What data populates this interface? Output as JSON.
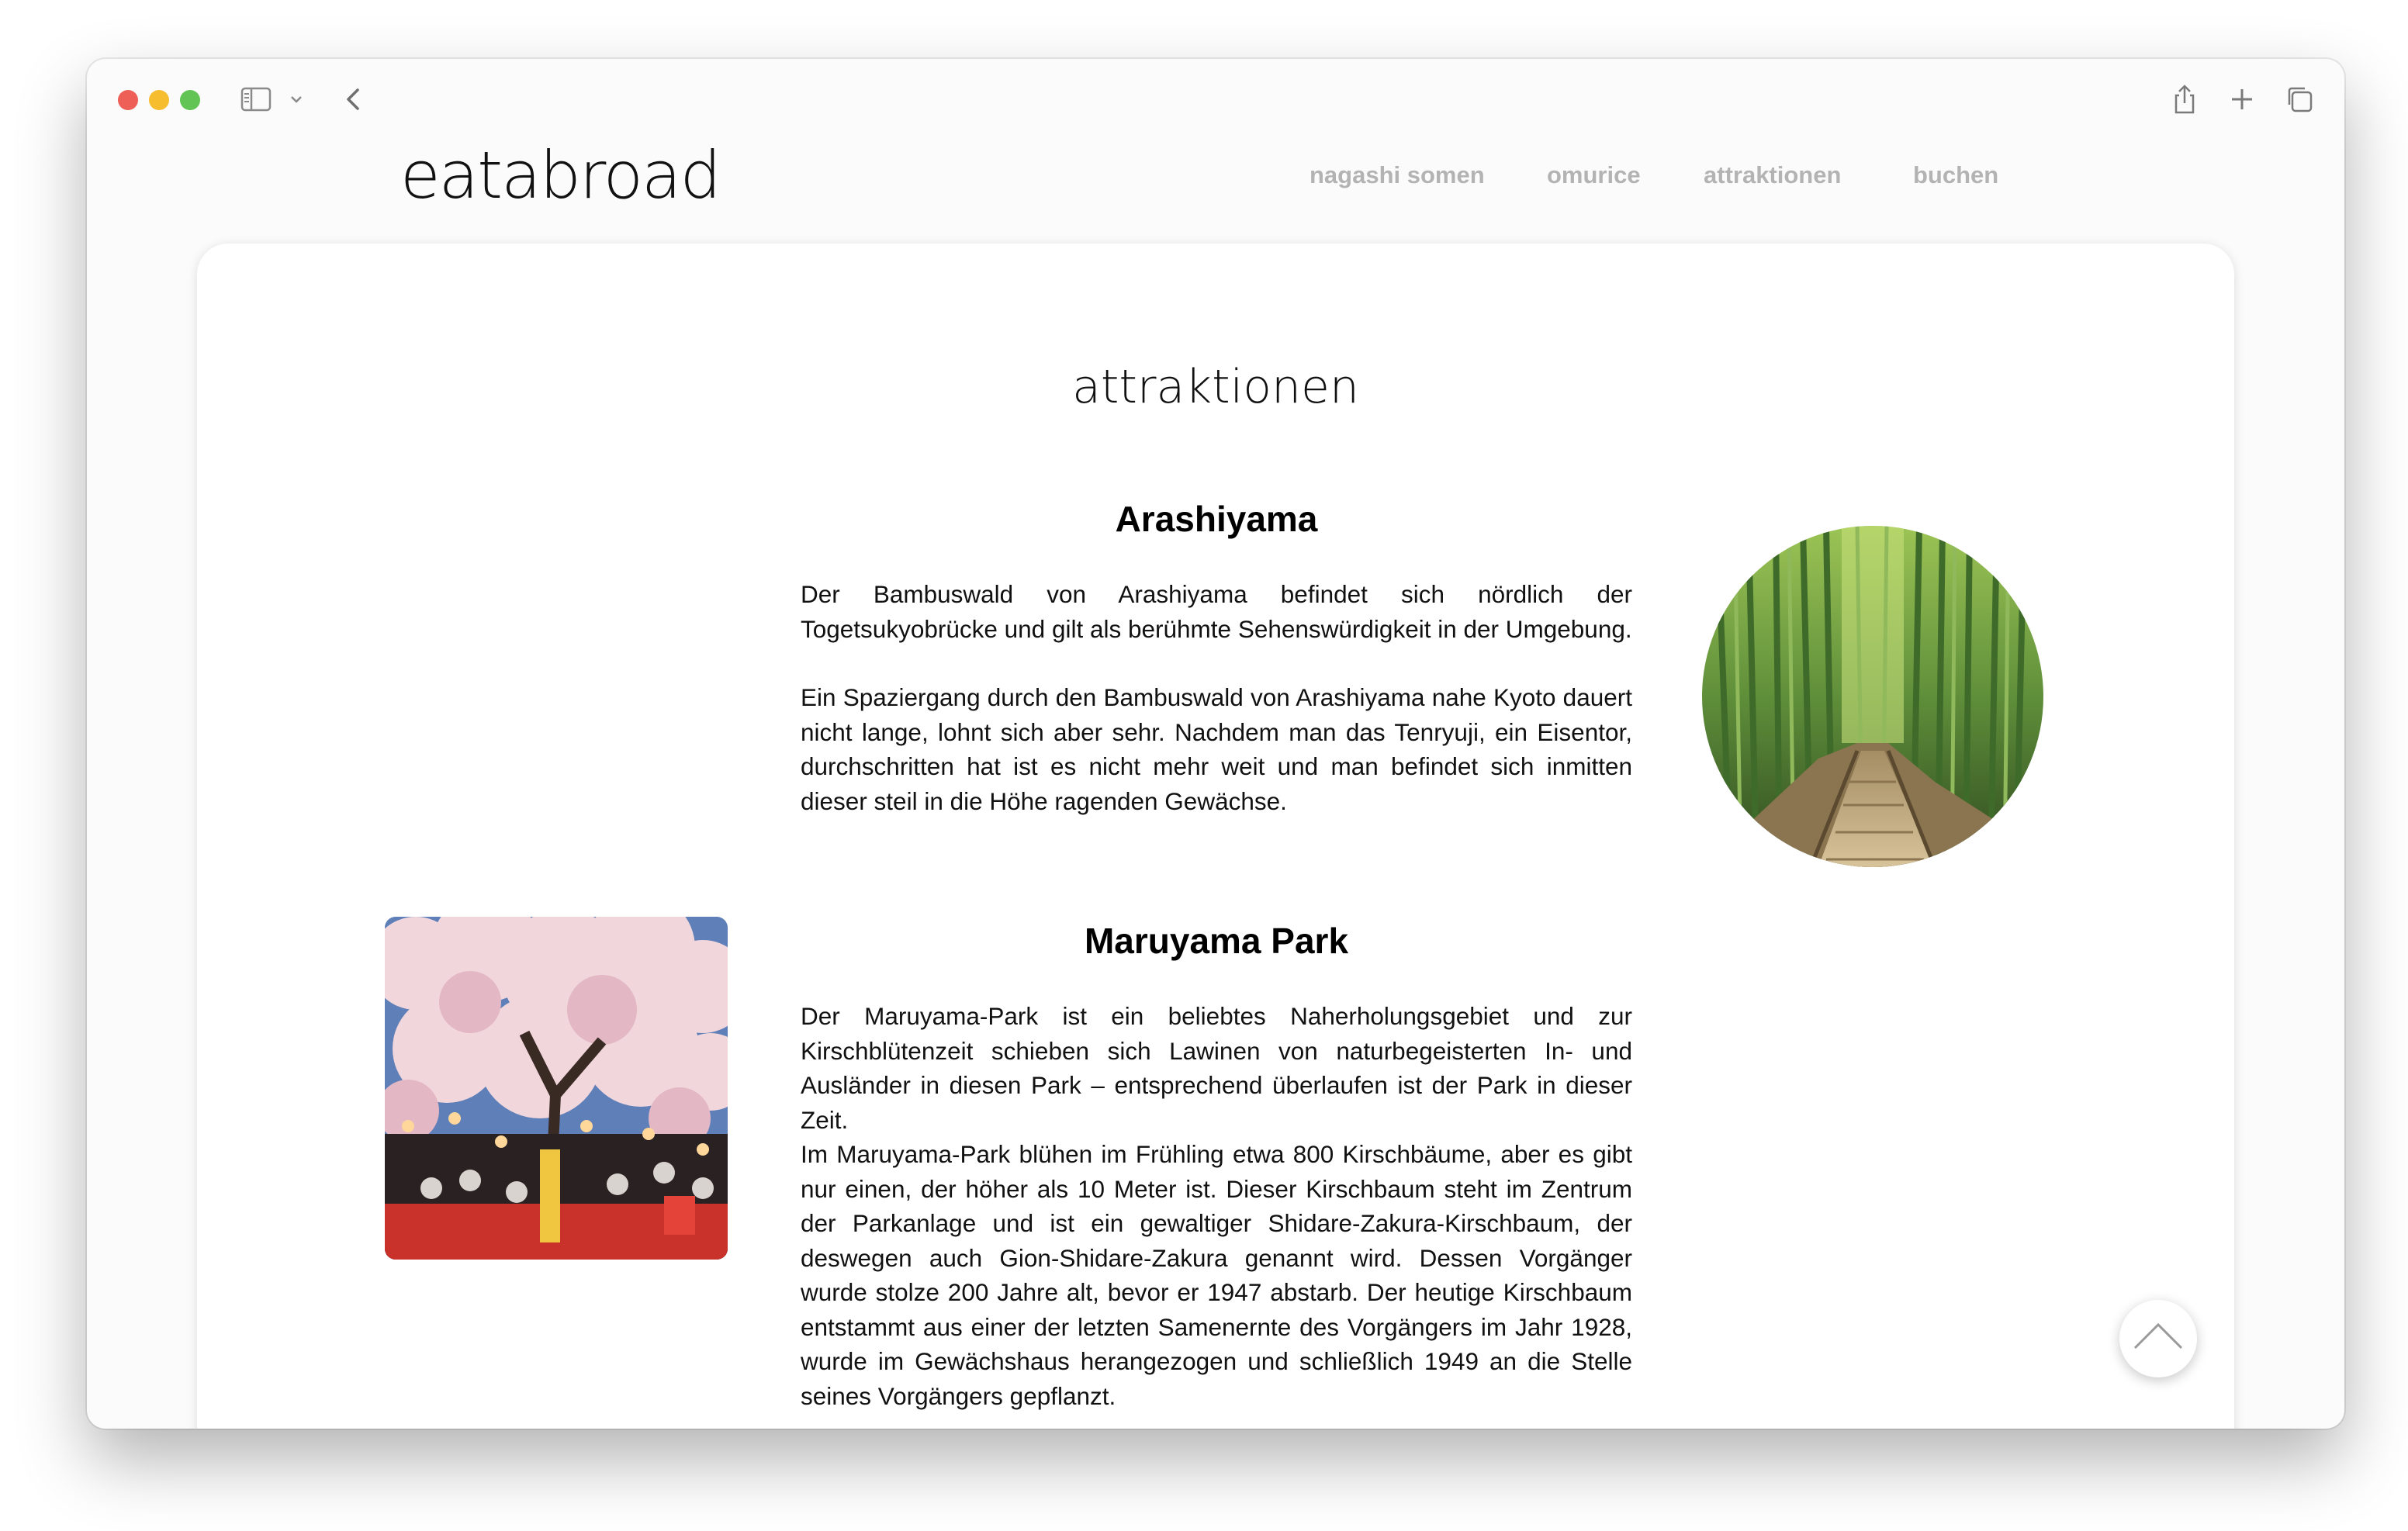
{
  "site": {
    "logo": "eatabroad",
    "nav": [
      {
        "label": "nagashi somen"
      },
      {
        "label": "omurice"
      },
      {
        "label": "attraktionen"
      },
      {
        "label": "buchen"
      }
    ]
  },
  "page": {
    "title": "attraktionen",
    "sections": [
      {
        "heading": "Arashiyama",
        "paragraphs": [
          "Der Bambuswald von Arashiyama befindet sich nördlich der Togetsukyobrücke und gilt als berühmte Sehenswürdigkeit in der Umgebung.",
          "Ein Spaziergang durch den Bambuswald von Arashiyama nahe Kyoto dauert nicht lange, lohnt sich aber sehr. Nachdem man das Tenryuji, ein Eisentor, durchschritten hat ist es nicht mehr weit und man befindet sich inmitten dieser steil in die Höhe ragenden Gewächse."
        ],
        "image": "bamboo-forest-path"
      },
      {
        "heading": "Maruyama Park",
        "paragraphs": [
          "Der Maruyama-Park ist ein beliebtes Naherholungsgebiet und zur Kirschblütenzeit schieben sich Lawinen von naturbegeisterten In- und Ausländer in diesen Park – entsprechend überlaufen ist der Park in dieser Zeit.",
          "Im Maruyama-Park blühen im Frühling etwa 800 Kirschbäume, aber es gibt nur einen, der höher als 10 Meter ist. Dieser Kirschbaum steht im Zentrum der Parkanlage und ist ein gewaltiger Shidare-Zakura-Kirschbaum, der deswegen auch Gion-Shidare-Zakura genannt wird. Dessen Vorgänger wurde stolze 200 Jahre alt, bevor er 1947 abstarb. Der heutige Kirschbaum entstammt aus einer der letzten Samenernte des Vorgängers im Jahr 1928, wurde im Gewächshaus herangezogen und schließlich 1949 an die Stelle seines Vorgängers gepflanzt."
        ],
        "image": "cherry-blossom-festival"
      }
    ]
  },
  "browser": {
    "icons": [
      "sidebar-icon",
      "chevron-down-icon",
      "back-arrow-icon",
      "share-icon",
      "new-tab-plus-icon",
      "tabs-overview-icon"
    ]
  },
  "colors": {
    "nav": "#b3b3b3",
    "text": "#111111",
    "card": "#ffffff",
    "window": "#fbfbfb"
  }
}
